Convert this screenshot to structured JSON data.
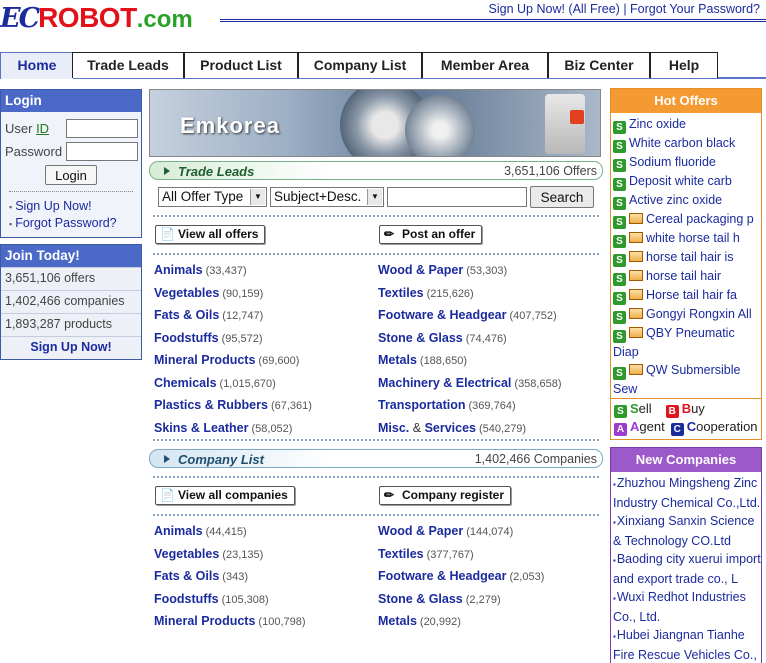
{
  "logo": {
    "ec": "EC",
    "robot": "ROBOT",
    "com": ".com"
  },
  "toplinks": {
    "signup": "Sign Up Now! (All Free)",
    "sep": "|",
    "forgot": "Forgot Your Password?"
  },
  "tabs": [
    "Home",
    "Trade Leads",
    "Product List",
    "Company List",
    "Member Area",
    "Biz Center",
    "Help"
  ],
  "login": {
    "title": "Login",
    "user_label_prefix": "User ",
    "user_label_id": "ID",
    "password_label": "Password",
    "button": "Login",
    "signup_link": "Sign Up Now!",
    "forgot_link": "Forgot Password?"
  },
  "join": {
    "title": "Join Today!",
    "offers": "3,651,106 offers",
    "companies": "1,402,466 companies",
    "products": "1,893,287 products",
    "signup": "Sign Up Now!"
  },
  "banner": {
    "text": "Emkorea"
  },
  "trade_leads": {
    "title": "Trade Leads",
    "count": "3,651,106 Offers",
    "offer_type": "All Offer Type",
    "search_field": "Subject+Desc.",
    "search_button": "Search",
    "view_all": "View all offers",
    "post": "Post an offer",
    "categories": [
      {
        "name": "Animals",
        "count": "(33,437)"
      },
      {
        "name": "Wood & Paper",
        "count": "(53,303)"
      },
      {
        "name": "Vegetables",
        "count": "(90,159)"
      },
      {
        "name": "Textiles",
        "count": "(215,626)"
      },
      {
        "name": "Fats & Oils",
        "count": "(12,747)"
      },
      {
        "name": "Footware & Headgear",
        "count": "(407,752)"
      },
      {
        "name": "Foodstuffs",
        "count": "(95,572)"
      },
      {
        "name": "Stone & Glass",
        "count": "(74,476)"
      },
      {
        "name": "Mineral Products",
        "count": "(69,600)"
      },
      {
        "name": "Metals",
        "count": "(188,650)"
      },
      {
        "name": "Chemicals",
        "count": "(1,015,670)"
      },
      {
        "name": "Machinery & Electrical",
        "count": "(358,658)"
      },
      {
        "name": "Plastics & Rubbers",
        "count": "(67,361)"
      },
      {
        "name": "Transportation",
        "count": "(369,764)"
      },
      {
        "name": "Skins & Leather",
        "count": "(58,052)"
      },
      {
        "name": "Misc.",
        "amp": " & ",
        "name2": "Services",
        "count": "(540,279)"
      }
    ]
  },
  "company_list": {
    "title": "Company List",
    "count": "1,402,466 Companies",
    "view_all": "View all companies",
    "register": "Company register",
    "categories": [
      {
        "name": "Animals",
        "count": "(44,415)"
      },
      {
        "name": "Wood & Paper",
        "count": "(144,074)"
      },
      {
        "name": "Vegetables",
        "count": "(23,135)"
      },
      {
        "name": "Textiles",
        "count": "(377,767)"
      },
      {
        "name": "Fats & Oils",
        "count": "(343)"
      },
      {
        "name": "Footware & Headgear",
        "count": "(2,053)"
      },
      {
        "name": "Foodstuffs",
        "count": "(105,308)"
      },
      {
        "name": "Stone & Glass",
        "count": "(2,279)"
      },
      {
        "name": "Mineral Products",
        "count": "(100,798)"
      },
      {
        "name": "Metals",
        "count": "(20,992)"
      }
    ]
  },
  "hot_offers": {
    "title": "Hot Offers",
    "items": [
      {
        "text": "Zinc oxide",
        "pic": false
      },
      {
        "text": "White carbon black",
        "pic": false
      },
      {
        "text": "Sodium fluoride",
        "pic": false
      },
      {
        "text": "Deposit white carb",
        "pic": false
      },
      {
        "text": "Active zinc oxide",
        "pic": false
      },
      {
        "text": "Cereal packaging p",
        "pic": true
      },
      {
        "text": "white horse tail h",
        "pic": true
      },
      {
        "text": "horse tail hair is",
        "pic": true
      },
      {
        "text": "horse tail hair",
        "pic": true
      },
      {
        "text": "Horse tail hair fa",
        "pic": true
      },
      {
        "text": "Gongyi Rongxin All",
        "pic": true
      },
      {
        "text": "QBY Pneumatic",
        "line2": "Diap",
        "pic": true
      },
      {
        "text": "QW Submersible",
        "line2": "Sew",
        "pic": true
      }
    ],
    "legend": {
      "sell": "Sell",
      "buy": "Buy",
      "agent": "Agent",
      "coop": "Cooperation"
    },
    "colors": {
      "sell": "#2e9a2e",
      "buy": "#e0141e",
      "agent": "#9b3bd0",
      "coop": "#1b2b9e"
    }
  },
  "new_companies": {
    "title": "New Companies",
    "items": [
      "Zhuzhou Mingsheng Zinc Industry Chemical Co.,Ltd.",
      "Xinxiang Sanxin Science & Technology CO.Ltd",
      "Baoding city xuerui import and export trade co., L",
      "Wuxi Redhot Industries Co., Ltd.",
      "Hubei Jiangnan Tianhe Fire Rescue Vehicles Co., Ltd."
    ]
  }
}
